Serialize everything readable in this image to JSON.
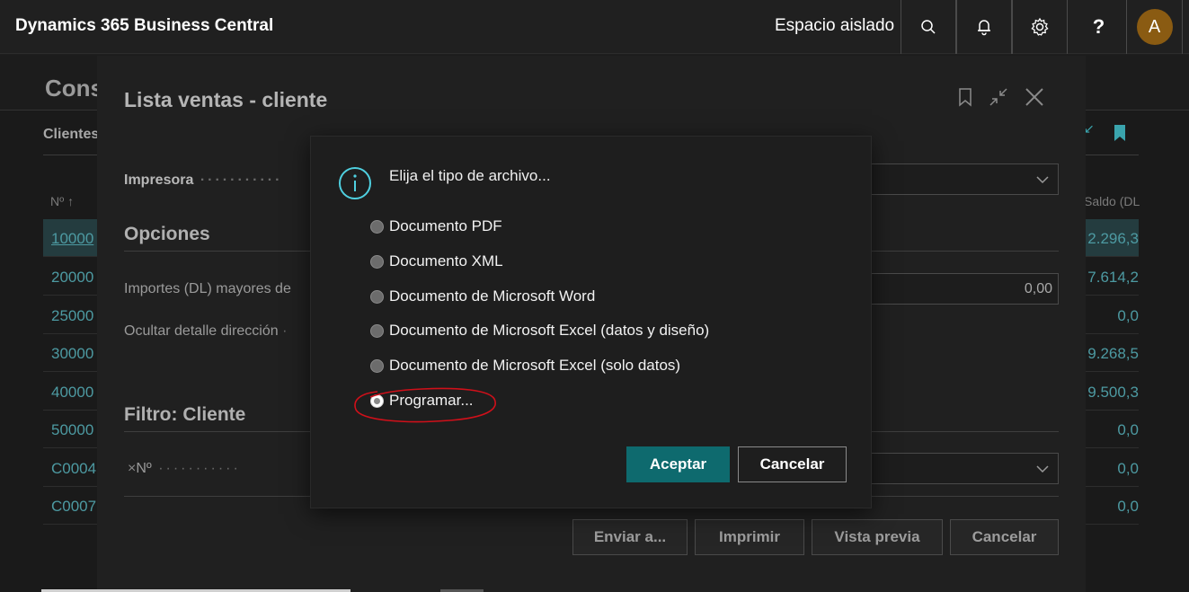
{
  "topbar": {
    "app_title": "Dynamics 365 Business Central",
    "environment": "Espacio aislado",
    "search_icon": "search-icon",
    "bell_icon": "bell-icon",
    "gear_icon": "gear-icon",
    "help_label": "?",
    "avatar_initial": "A"
  },
  "background_page": {
    "title": "Cons",
    "subtitle": "Clientes",
    "col_no": "Nº ↑",
    "col_balance": "Saldo (DL",
    "rows": [
      {
        "no": "10000",
        "balance": "2.296,3"
      },
      {
        "no": "20000",
        "balance": "7.614,2"
      },
      {
        "no": "25000",
        "balance": "0,0"
      },
      {
        "no": "30000",
        "balance": "9.268,5"
      },
      {
        "no": "40000",
        "balance": "9.500,3"
      },
      {
        "no": "50000",
        "balance": "0,0"
      },
      {
        "no": "C0004(",
        "balance": "0,0"
      },
      {
        "no": "C0007(",
        "balance": "0,0"
      }
    ]
  },
  "request_page": {
    "title": "Lista ventas - cliente",
    "printer_label": "Impresora",
    "options_heading": "Opciones",
    "amounts_label": "Importes (DL) mayores de",
    "amounts_value": "0,00",
    "hide_address_label": "Ocultar detalle dirección",
    "filter_heading": "Filtro: Cliente",
    "filter_field_label": "Nº",
    "buttons": {
      "send": "Enviar a...",
      "print": "Imprimir",
      "preview": "Vista previa",
      "cancel": "Cancelar"
    }
  },
  "modal": {
    "question": "Elija el tipo de archivo...",
    "options": [
      {
        "label": "Documento PDF",
        "selected": false
      },
      {
        "label": "Documento XML",
        "selected": false
      },
      {
        "label": "Documento de Microsoft Word",
        "selected": false
      },
      {
        "label": "Documento de Microsoft Excel (datos y diseño)",
        "selected": false
      },
      {
        "label": "Documento de Microsoft Excel (solo datos)",
        "selected": false
      },
      {
        "label": "Programar...",
        "selected": true
      }
    ],
    "ok_label": "Aceptar",
    "cancel_label": "Cancelar"
  },
  "colors": {
    "accent": "#0e6a6e",
    "link": "#4d9aa2",
    "info_icon": "#4fd0e0",
    "annotation": "#d0101a",
    "avatar_bg": "#8a5b12"
  }
}
